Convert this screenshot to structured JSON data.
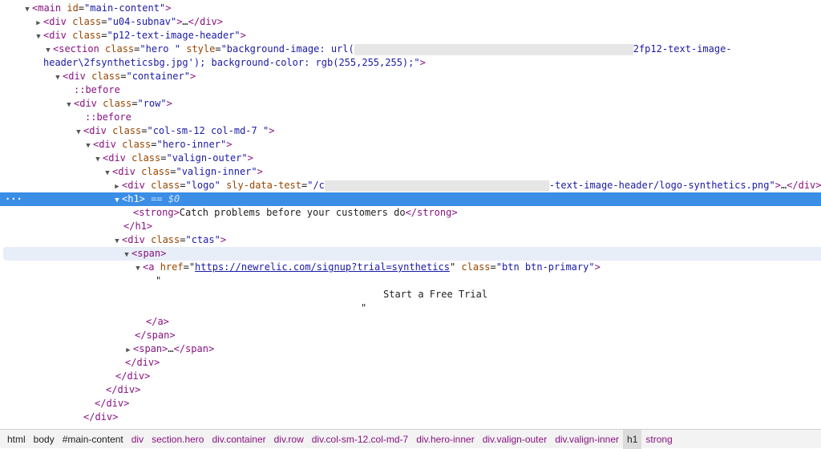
{
  "tree": {
    "main_tag": "<main",
    "main_id_attr": "id",
    "main_id_val": "\"main-content\"",
    "subnav_val": "\"u04-subnav\"",
    "header_val": "\"p12-text-image-header\"",
    "section_class": "\"hero \"",
    "section_style_start": "\"background-image: url(",
    "section_style_mid": "2fp12-text-image-",
    "section_style_end": "header\\2fsyntheticsbg.jpg'); background-color: rgb(255,255,255);\"",
    "container_val": "\"container\"",
    "before": "::before",
    "row_val": "\"row\"",
    "col_val": "\"col-sm-12 col-md-7 \"",
    "hero_inner_val": "\"hero-inner\"",
    "valign_outer_val": "\"valign-outer\"",
    "valign_inner_val": "\"valign-inner\"",
    "logo_val": "\"logo\"",
    "logo_attr2": "sly-data-test",
    "logo_attr2_start": "\"/c",
    "logo_attr2_end": "-text-image-header/logo-synthetics.png\"",
    "h1_eq": "== $0",
    "strong_text": "Catch problems before your customers do",
    "ctas_val": "\"ctas\"",
    "href_val": "https://newrelic.com/signup?trial=synthetics",
    "btn_val": "\"btn btn-primary\"",
    "quote": "\"",
    "cta_text": "Start a Free Trial",
    "dots": "…"
  },
  "breadcrumbs": [
    "html",
    "body",
    "#main-content",
    "div",
    "section.hero",
    "div.container",
    "div.row",
    "div.col-sm-12.col-md-7",
    "div.hero-inner",
    "div.valign-outer",
    "div.valign-inner",
    "h1",
    "strong"
  ],
  "colors": {
    "selection": "#3a8ee6",
    "tag": "#881280",
    "attribute": "#994500",
    "value": "#1a1aa6"
  }
}
